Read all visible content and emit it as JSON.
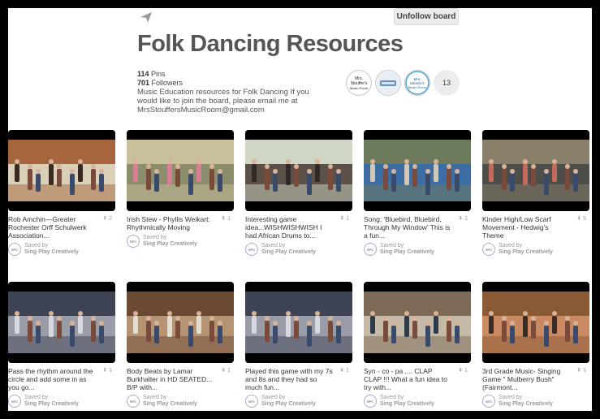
{
  "header": {
    "unfollow_label": "Unfollow board",
    "title": "Folk Dancing Resources",
    "pins_count": "114",
    "pins_label": "Pins",
    "followers_count": "701",
    "followers_label": "Followers",
    "description": "Music Education resources for Folk Dancing If you would like to join the board, please email me at MrsStouffersMusicRoom@gmail.com",
    "collaborator_count": "13"
  },
  "collaborators": [
    {
      "name": "Mrs. Stouffer's Music Room"
    },
    {
      "name": "collaborator-2"
    },
    {
      "name": "Mrs. Miracle's Music Room"
    }
  ],
  "saved_by_label": "Saved by",
  "saved_by_name": "Sing Play Creatively",
  "pins": [
    {
      "desc": "Rob Amchin—Greater Rochester Orff Schulwerk Association...",
      "repins": "2",
      "colors": [
        "#a7653d",
        "#d9d0b7",
        "#3b2a22"
      ]
    },
    {
      "desc": "Irish Stew - Phyllis Weikart: Rhythmically Moving",
      "repins": "1",
      "colors": [
        "#c8c09a",
        "#8c8d6c",
        "#d87f96"
      ]
    },
    {
      "desc": "Interesting game idea...WISHWISHWISH I had African Drums to...",
      "repins": "1",
      "colors": [
        "#cfd7c4",
        "#5c5148",
        "#2f2a27"
      ]
    },
    {
      "desc": "Song: 'Bluebird, Bluebird, Through My Window' This is a fun...",
      "repins": "1",
      "colors": [
        "#6d7a5c",
        "#3d6ea3",
        "#d0c9b6"
      ]
    },
    {
      "desc": "Kinder High/Low Scarf Movement - Hedwig's Theme",
      "repins": "5",
      "colors": [
        "#8a8069",
        "#4d4d4a",
        "#c26b5a"
      ]
    },
    {
      "desc": "Pass the rhythm around the circle and add some in as you go...",
      "repins": "1",
      "colors": [
        "#3f4454",
        "#9a9ca8",
        "#d7d7e0"
      ]
    },
    {
      "desc": "Body Beats by Lamar Burkhalter in HD SEATED... B/P with...",
      "repins": "1",
      "colors": [
        "#6b4a33",
        "#b59474",
        "#e4ded2"
      ]
    },
    {
      "desc": "Played this game with my 7s and 8s and they had so much fun...",
      "repins": "1",
      "colors": [
        "#3f4454",
        "#9a9ca8",
        "#d7d7e0"
      ]
    },
    {
      "desc": "Syn - co - pa .... CLAP CLAP !!! What a fun idea to try with...",
      "repins": "1",
      "colors": [
        "#7d6a57",
        "#c5b9a7",
        "#2d3b4a"
      ]
    },
    {
      "desc": "3rd Grade Music- Singing Game \" Mulberry Bush\" (Fairmont...",
      "repins": "1",
      "colors": [
        "#8a5a35",
        "#c98a62",
        "#3b2b25"
      ]
    }
  ],
  "colors": {
    "title": "#555555",
    "background": "#ffffff",
    "frame": "#000000"
  }
}
